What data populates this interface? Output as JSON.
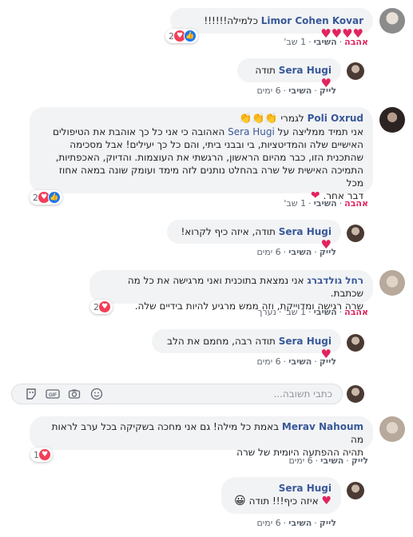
{
  "comments": [
    {
      "author": "Limor Cohen Kovar",
      "text": "כלמילה!!!!!!",
      "emoji": "♥♥♥♥",
      "actions": {
        "love": "אהבה",
        "reply": "השיבי",
        "time": "1 שב'"
      },
      "reactions": {
        "count": "2"
      }
    },
    {
      "author": "Sera Hugi",
      "text": "תודה",
      "emoji": "♥",
      "actions": {
        "like": "לייק",
        "reply": "השיבי",
        "time": "6 ימים"
      }
    },
    {
      "author": "Poli Oxrud",
      "lead": "לגמרי",
      "lead_emoji": "👏👏👏",
      "line1_pre": "אני תמיד ממליצה על",
      "line1_mention": "Sera Hugi",
      "line1_post": "האהובה כי אני כל כך אוהבת את הטיפולים",
      "line2": "האישיים שלה והמדיטציות, בי ובבני ביתי, והם כל כך יעילים! אבל מסכימה",
      "line3": "שהתכנית הזו, כבר מהיום הראשון, הרגשתי את העוצמות. והדיוק, האכפתיות,",
      "line4": "התמיכה האישית של שרה בהחלט נותנים לזה מימד ועומק שונה במאה אחוז מכל",
      "line5": "דבר אחר.",
      "line5_emoji": "❤",
      "actions": {
        "love": "אהבה",
        "reply": "השיבי",
        "time": "1 שב'"
      },
      "reactions": {
        "count": "2"
      }
    },
    {
      "author": "Sera Hugi",
      "text": "תודה, איזה כיף לקרוא!",
      "emoji": "♥",
      "actions": {
        "like": "לייק",
        "reply": "השיבי",
        "time": "6 ימים"
      }
    },
    {
      "author": "רחל גולדברג",
      "line1": "אני נמצאת בתוכנית ואני מרגישה את כל מה שכתבת.",
      "line2": "שרה רגישה ומדוייקת, וזה ממש מרגיע להיות בידיים שלה.",
      "actions": {
        "love": "אהבה",
        "reply": "השיבי",
        "time": "1 שב'",
        "edited": "נערך"
      },
      "reactions": {
        "count": "2"
      }
    },
    {
      "author": "Sera Hugi",
      "text": "תודה רבה, מחמם את הלב",
      "emoji": "♥",
      "actions": {
        "like": "לייק",
        "reply": "השיבי",
        "time": "6 ימים"
      }
    },
    {
      "author": "Merav Nahoum",
      "line1": "באמת כל מילה! גם אני מחכה בשקיקה בכל ערב לראות מה",
      "line2": "תהיה ההפתעה היומית של שרה",
      "actions": {
        "like": "לייק",
        "reply": "השיבי",
        "time": "6 ימים"
      },
      "reactions": {
        "count": "1"
      }
    },
    {
      "author": "Sera Hugi",
      "text": "איזה כיף!!! תודה",
      "emoji_start": "😀",
      "emoji_end": "♥",
      "actions": {
        "like": "לייק",
        "reply": "השיבי",
        "time": "6 ימים"
      }
    }
  ],
  "reply_box": {
    "placeholder": "כתבי תשובה...",
    "icons": [
      "smiley-icon",
      "camera-icon",
      "gif-icon",
      "sticker-icon"
    ]
  },
  "colors": {
    "link": "#385898",
    "love": "#e0245e",
    "bubble": "#f2f3f5",
    "like": "#1877f2"
  }
}
